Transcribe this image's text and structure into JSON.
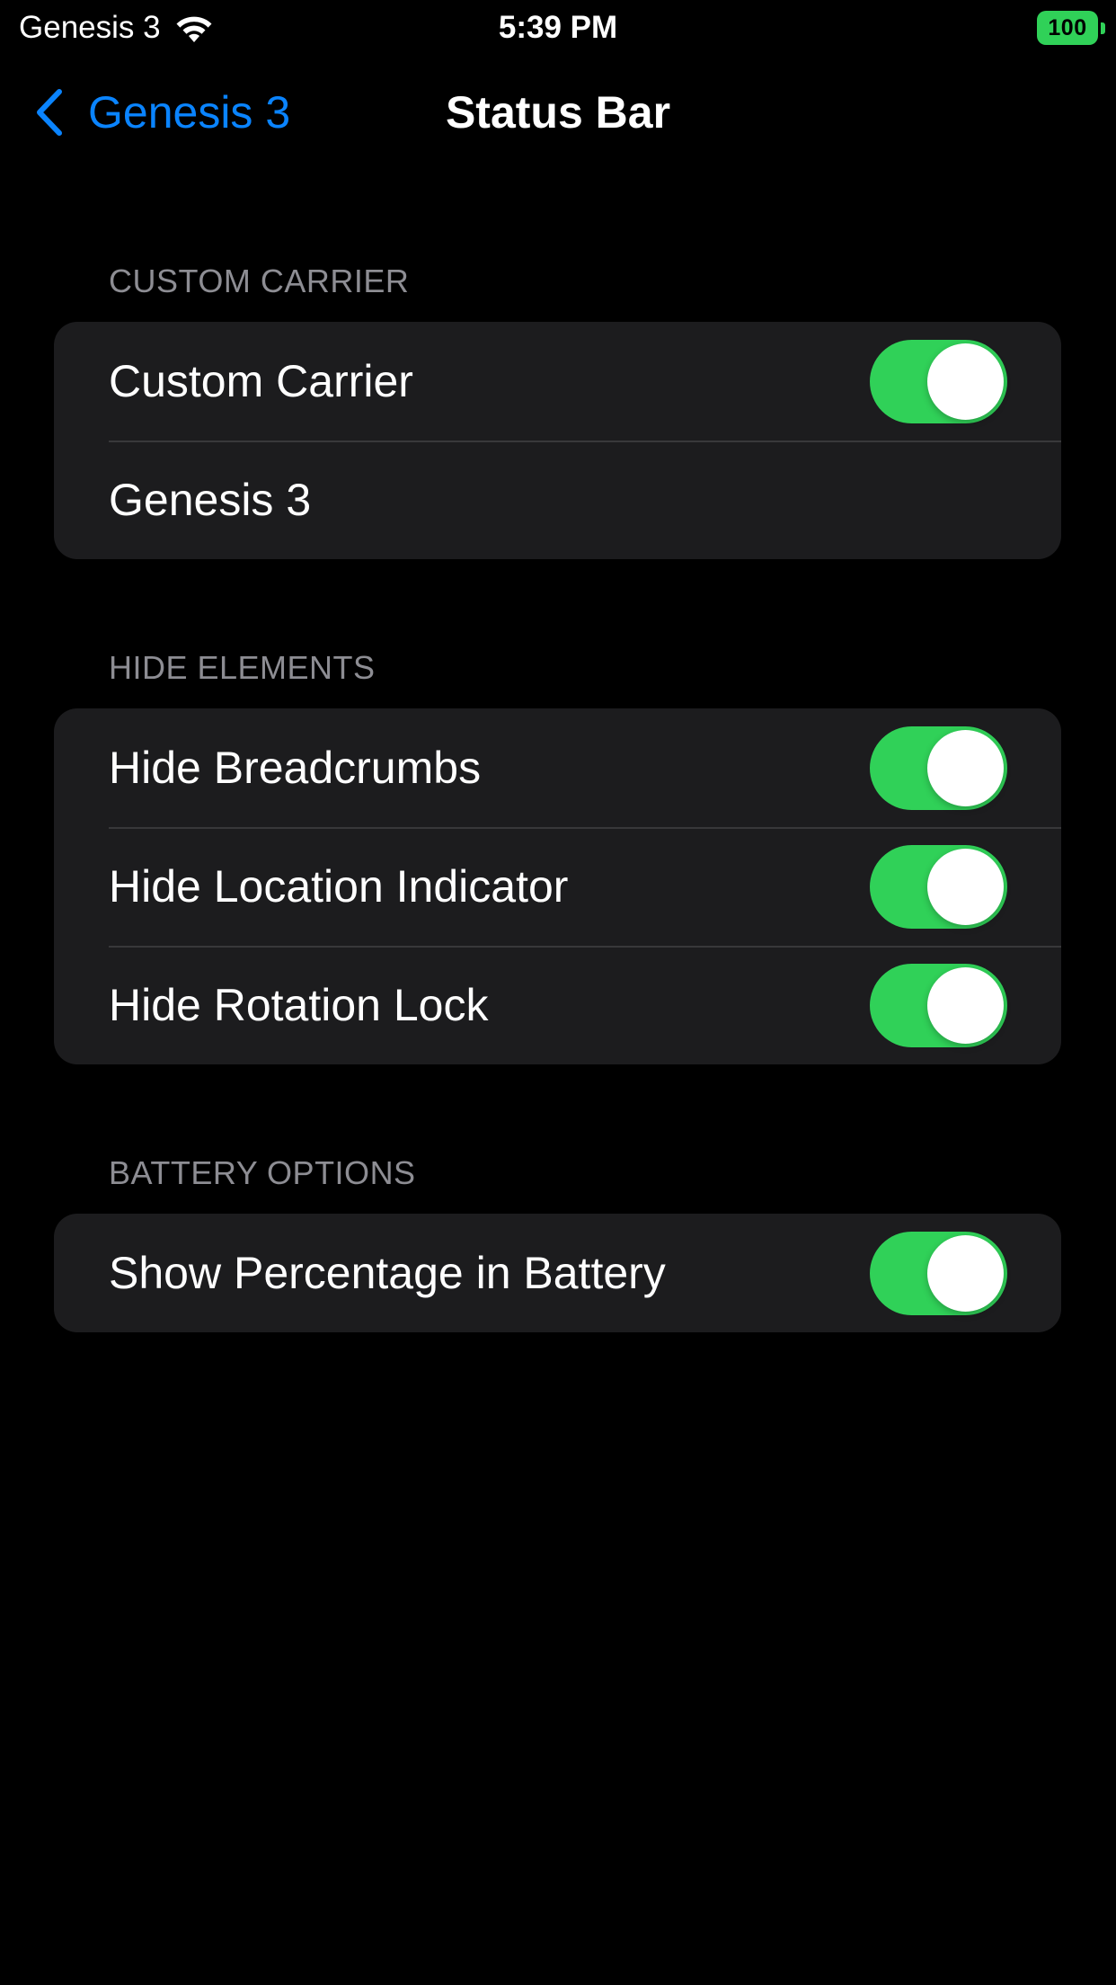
{
  "status_bar": {
    "carrier": "Genesis 3",
    "wifi_icon": "wifi-icon",
    "time": "5:39 PM",
    "battery_level": "100",
    "battery_color": "#30d158"
  },
  "nav": {
    "back_icon": "chevron-left-icon",
    "back_label": "Genesis 3",
    "title": "Status Bar",
    "accent_color": "#0a84ff"
  },
  "sections": [
    {
      "header": "CUSTOM CARRIER",
      "rows": [
        {
          "label": "Custom Carrier",
          "type": "toggle",
          "on": true
        },
        {
          "label": "Genesis 3",
          "type": "text-field"
        }
      ]
    },
    {
      "header": "HIDE ELEMENTS",
      "rows": [
        {
          "label": "Hide Breadcrumbs",
          "type": "toggle",
          "on": true
        },
        {
          "label": "Hide Location Indicator",
          "type": "toggle",
          "on": true
        },
        {
          "label": "Hide Rotation Lock",
          "type": "toggle",
          "on": true
        }
      ]
    },
    {
      "header": "BATTERY OPTIONS",
      "rows": [
        {
          "label": "Show Percentage in Battery",
          "type": "toggle",
          "on": true
        }
      ]
    }
  ],
  "toggle_on_color": "#30d158"
}
